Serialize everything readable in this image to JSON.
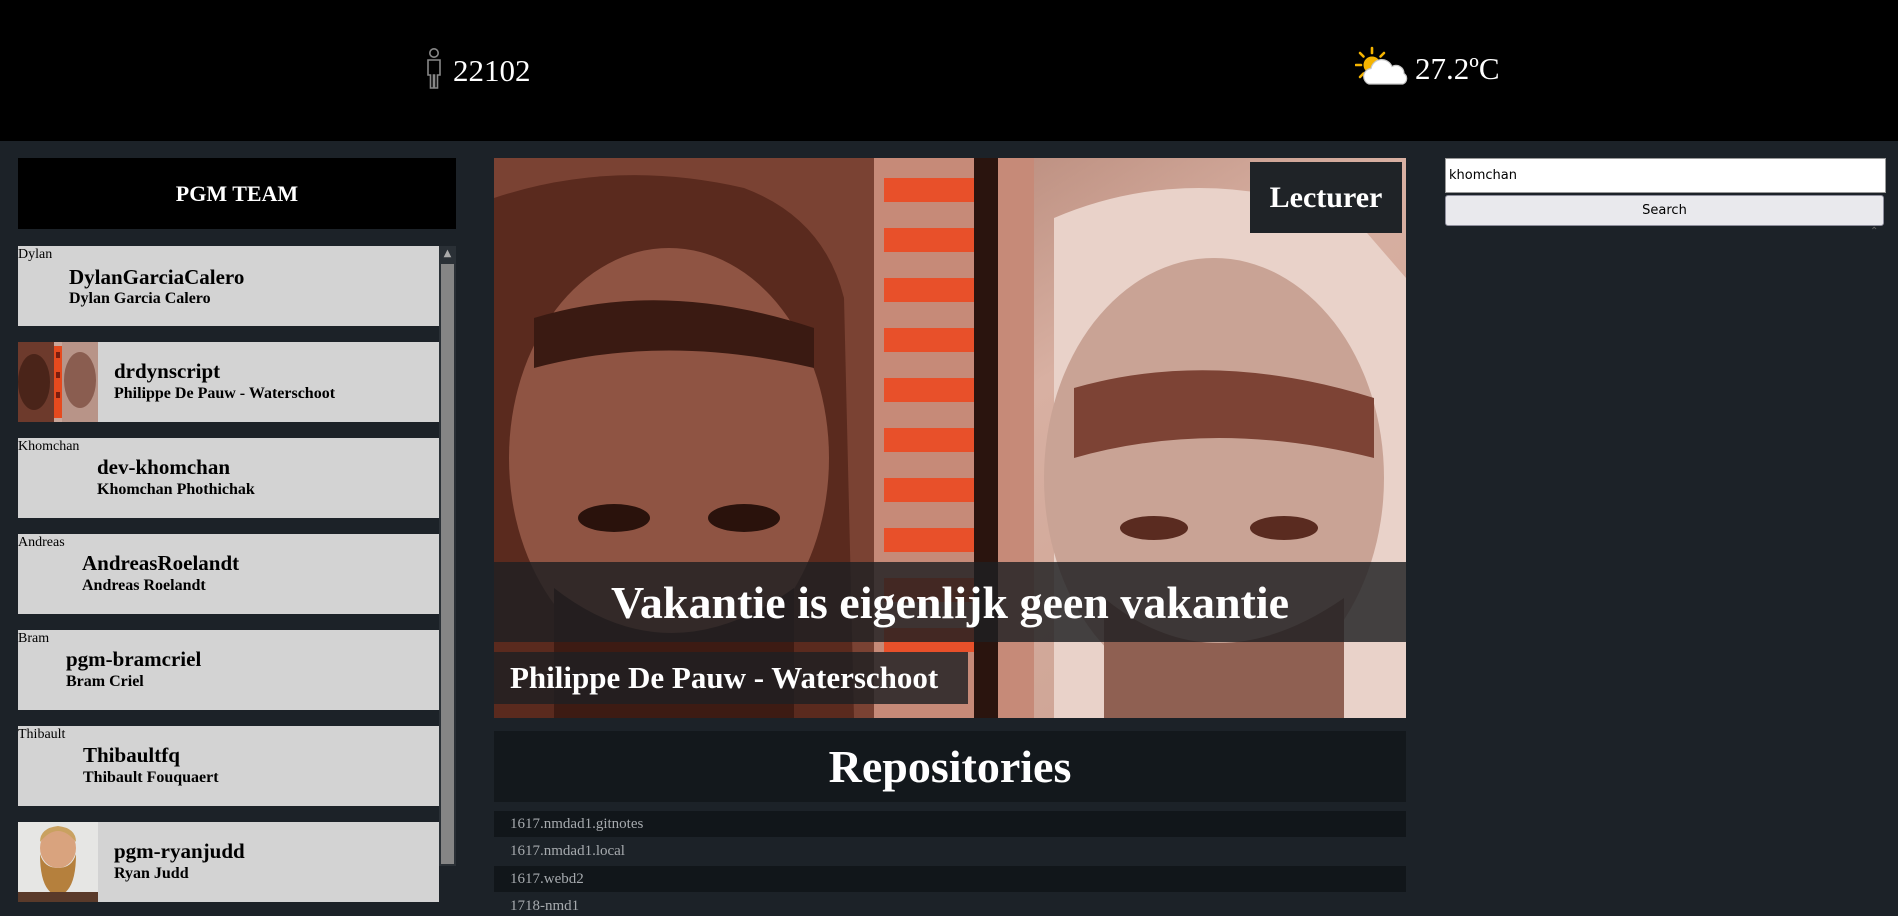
{
  "header": {
    "visitor_icon": "person-icon",
    "visitor_count": "22102",
    "weather_icon": "partly-cloudy-sun-icon",
    "temperature": "27.2ºC"
  },
  "sidebar": {
    "title": "PGM TEAM",
    "members": [
      {
        "alt": "Dylan",
        "login": "DylanGarciaCalero",
        "name": "Dylan Garcia Calero",
        "has_avatar": false
      },
      {
        "alt": "",
        "login": "drdynscript",
        "name": "Philippe De Pauw - Waterschoot",
        "has_avatar": true
      },
      {
        "alt": "Khomchan",
        "login": "dev-khomchan",
        "name": "Khomchan Phothichak",
        "has_avatar": false
      },
      {
        "alt": "Andreas",
        "login": "AndreasRoelandt",
        "name": "Andreas Roelandt",
        "has_avatar": false
      },
      {
        "alt": "Bram",
        "login": "pgm-bramcriel",
        "name": "Bram Criel",
        "has_avatar": false
      },
      {
        "alt": "Thibault",
        "login": "Thibaultfq",
        "name": "Thibault Fouquaert",
        "has_avatar": false
      },
      {
        "alt": "",
        "login": "pgm-ryanjudd",
        "name": "Ryan Judd",
        "has_avatar": true
      }
    ]
  },
  "profile": {
    "role": "Lecturer",
    "bio": "Vakantie is eigenlijk geen vakantie",
    "name": "Philippe De Pauw - Waterschoot"
  },
  "repositories": {
    "title": "Repositories",
    "items": [
      "1617.nmdad1.gitnotes",
      "1617.nmdad1.local",
      "1617.webd2",
      "1718-nmd1"
    ]
  },
  "search": {
    "value": "khomchan",
    "button_label": "Search"
  }
}
